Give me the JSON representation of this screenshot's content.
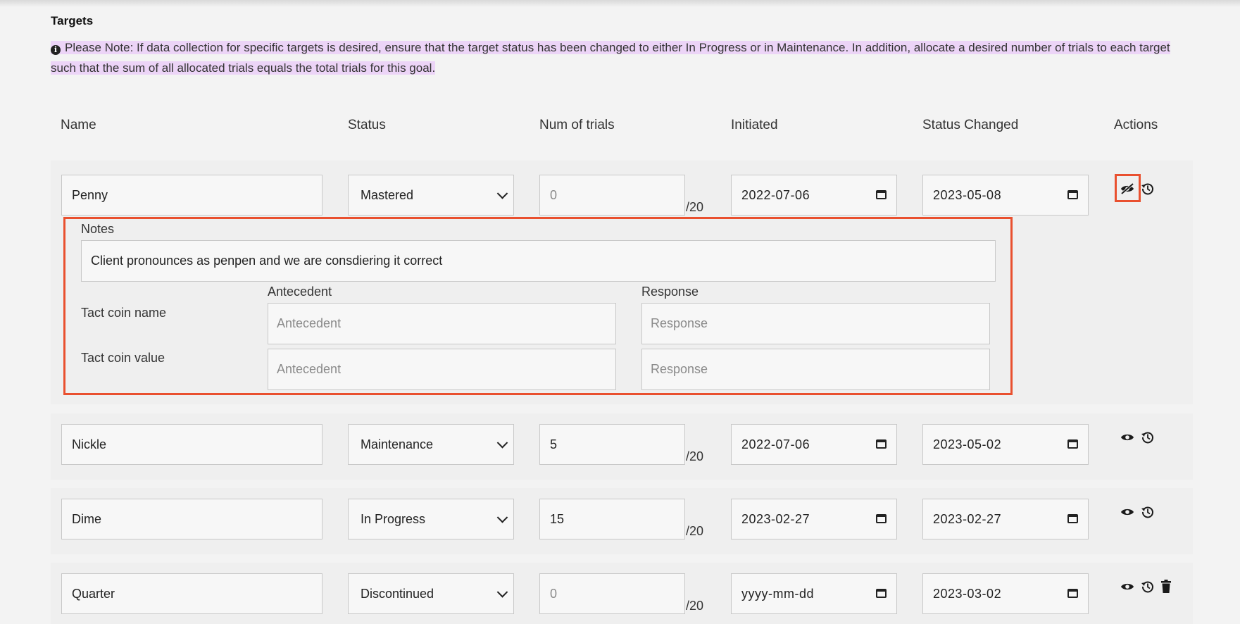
{
  "section_title": "Targets",
  "note_text": "Please Note: If data collection for specific targets is desired, ensure that the target status has been changed to either In Progress or in Maintenance. In addition, allocate a desired number of trials to each target such that the sum of all allocated trials equals the total trials for this goal.",
  "columns": {
    "name": "Name",
    "status": "Status",
    "num_trials": "Num of trials",
    "initiated": "Initiated",
    "status_changed": "Status Changed",
    "actions": "Actions"
  },
  "total_trials_suffix": "/20",
  "rows": [
    {
      "name": "Penny",
      "status": "Mastered",
      "trials": "0",
      "initiated": "2022-07-06",
      "status_changed": "2023-05-08"
    },
    {
      "name": "Nickle",
      "status": "Maintenance",
      "trials": "5",
      "initiated": "2022-07-06",
      "status_changed": "2023-05-02"
    },
    {
      "name": "Dime",
      "status": "In Progress",
      "trials": "15",
      "initiated": "2023-02-27",
      "status_changed": "2023-02-27"
    },
    {
      "name": "Quarter",
      "status": "Discontinued",
      "trials": "0",
      "initiated": "yyyy-mm-dd",
      "status_changed": "2023-03-02"
    }
  ],
  "expanded": {
    "notes_label": "Notes",
    "notes_value": "Client pronounces as penpen and we are consdiering it correct",
    "antecedent_label": "Antecedent",
    "response_label": "Response",
    "tact_name_label": "Tact coin name",
    "tact_value_label": "Tact coin value",
    "antecedent_placeholder": "Antecedent",
    "response_placeholder": "Response"
  },
  "icons": {
    "row1": [
      "eye-slash-icon",
      "history-icon"
    ],
    "row2": [
      "eye-icon",
      "history-icon"
    ],
    "row3": [
      "eye-icon",
      "history-icon"
    ],
    "row4": [
      "eye-icon",
      "history-icon",
      "trash-icon"
    ]
  },
  "colors": {
    "highlight_border": "#e9502f",
    "note_highlight": "#ecd4f7"
  }
}
